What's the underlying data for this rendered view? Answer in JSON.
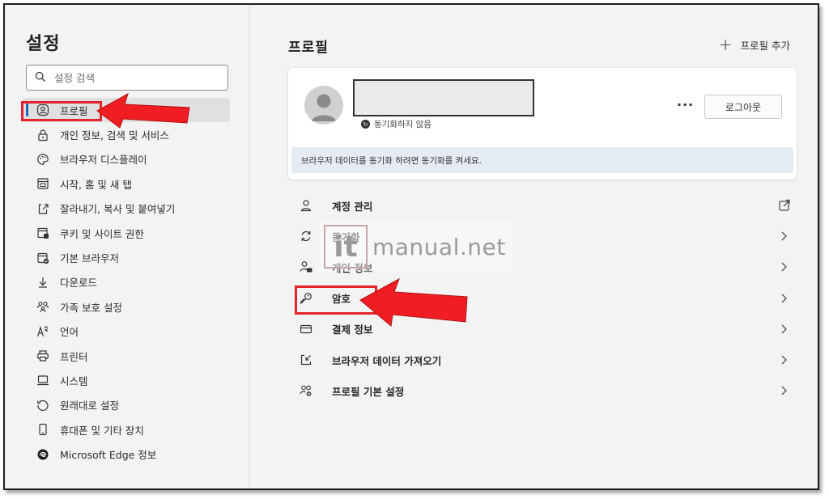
{
  "sidebar": {
    "title": "설정",
    "search": {
      "placeholder": "설정 검색",
      "icon": "search-icon"
    },
    "items": [
      {
        "label": "프로필",
        "icon": "profile-icon",
        "active": true
      },
      {
        "label": "개인 정보, 검색 및 서비스",
        "icon": "lock-icon"
      },
      {
        "label": "브라우저 디스플레이",
        "icon": "palette-icon"
      },
      {
        "label": "시작, 홈 및 새 탭",
        "icon": "home-tab-icon"
      },
      {
        "label": "잘라내기, 복사 및 붙여넣기",
        "icon": "clipboard-icon"
      },
      {
        "label": "쿠키 및 사이트 권한",
        "icon": "cookie-icon"
      },
      {
        "label": "기본 브라우저",
        "icon": "browser-icon"
      },
      {
        "label": "다운로드",
        "icon": "download-icon"
      },
      {
        "label": "가족 보호 설정",
        "icon": "family-icon"
      },
      {
        "label": "언어",
        "icon": "language-icon"
      },
      {
        "label": "프린터",
        "icon": "printer-icon"
      },
      {
        "label": "시스템",
        "icon": "laptop-icon"
      },
      {
        "label": "원래대로 설정",
        "icon": "reset-icon"
      },
      {
        "label": "휴대폰 및 기타 장치",
        "icon": "phone-icon"
      },
      {
        "label": "Microsoft Edge 정보",
        "icon": "edge-icon"
      }
    ]
  },
  "main": {
    "title": "프로필",
    "add_profile_label": "프로필 추가",
    "profile": {
      "sync_status": "동기화하지 않음",
      "more_label": "···",
      "logout_label": "로그아웃",
      "banner": "브라우저 데이터를 동기화 하려면 동기화를 켜세요."
    },
    "menu": [
      {
        "label": "계정 관리",
        "icon": "account-icon",
        "trailing": "external-link-icon"
      },
      {
        "label": "동기화",
        "icon": "sync-icon",
        "trailing": "chevron-right-icon"
      },
      {
        "label": "개인 정보",
        "icon": "personal-info-icon",
        "trailing": "chevron-right-icon"
      },
      {
        "label": "암호",
        "icon": "key-icon",
        "trailing": "chevron-right-icon"
      },
      {
        "label": "결제 정보",
        "icon": "card-icon",
        "trailing": "chevron-right-icon"
      },
      {
        "label": "브라우저 데이터 가져오기",
        "icon": "import-icon",
        "trailing": "chevron-right-icon"
      },
      {
        "label": "프로필 기본 설정",
        "icon": "profile-settings-icon",
        "trailing": "chevron-right-icon"
      }
    ]
  },
  "watermark": {
    "logo": "it",
    "text": "manual.net"
  },
  "colors": {
    "accent": "#0f6cbd",
    "annotation_red": "#e4232d",
    "banner": "#e4ebf3"
  }
}
